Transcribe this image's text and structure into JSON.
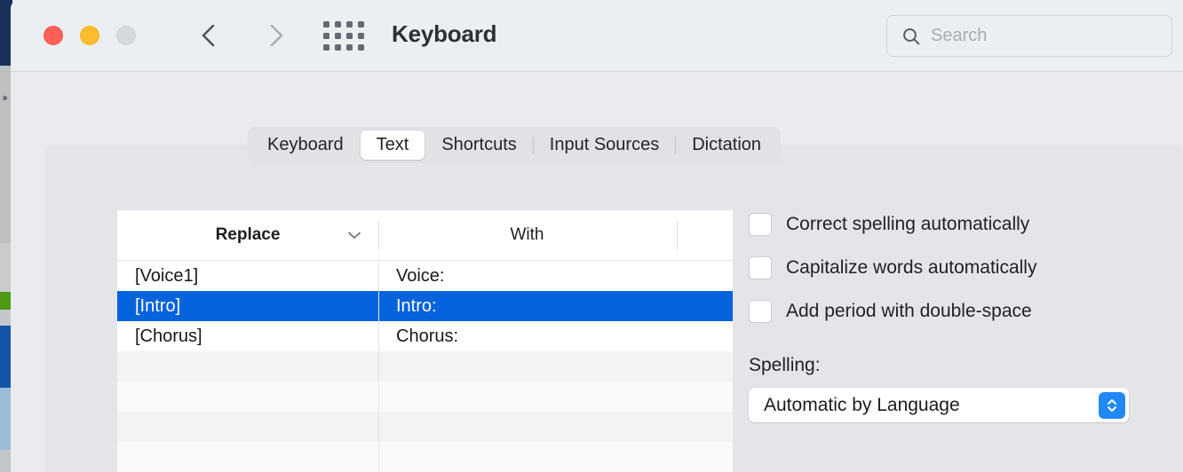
{
  "window": {
    "title": "Keyboard",
    "traffic_lights": [
      {
        "name": "close",
        "color": "#FF5F57"
      },
      {
        "name": "minimize",
        "color": "#FEBC2E"
      },
      {
        "name": "zoom",
        "color": "#D6D9DC"
      }
    ]
  },
  "toolbar": {
    "back_icon": "chevron-left-icon",
    "forward_icon": "chevron-right-icon",
    "grid_icon": "show-all-grid-icon",
    "search": {
      "icon": "search-icon",
      "value": "",
      "placeholder": "Search"
    }
  },
  "tabs": [
    {
      "label": "Keyboard",
      "selected": false
    },
    {
      "label": "Text",
      "selected": true
    },
    {
      "label": "Shortcuts",
      "selected": false
    },
    {
      "label": "Input Sources",
      "selected": false
    },
    {
      "label": "Dictation",
      "selected": false
    }
  ],
  "table": {
    "columns": [
      {
        "label": "Replace",
        "sorted": true,
        "sort_icon": "chevron-down-icon"
      },
      {
        "label": "With",
        "sorted": false
      }
    ],
    "rows": [
      {
        "replace": "[Voice1]",
        "with": "Voice:",
        "selected": false
      },
      {
        "replace": "[Intro]",
        "with": "Intro:",
        "selected": true
      },
      {
        "replace": "[Chorus]",
        "with": "Chorus:",
        "selected": false
      }
    ],
    "empty_row_count": 4,
    "selection_color": "#0563DC"
  },
  "options": {
    "checkboxes": [
      {
        "label": "Correct spelling automatically",
        "checked": false
      },
      {
        "label": "Capitalize words automatically",
        "checked": false
      },
      {
        "label": "Add period with double-space",
        "checked": false
      }
    ],
    "spelling": {
      "label": "Spelling:",
      "value": "Automatic by Language",
      "stepper_icon": "chevron-up-down-icon",
      "accent_color": "#2089F5"
    }
  }
}
